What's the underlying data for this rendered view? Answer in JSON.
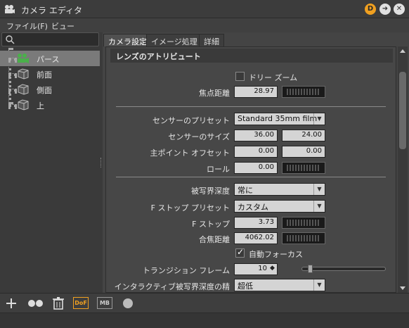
{
  "window": {
    "title": "カメラ エディタ",
    "buttons": {
      "d_label": "D",
      "go_label": "➜",
      "close_label": "✕"
    }
  },
  "menu": {
    "items": [
      "ファイル(F)",
      "ビュー"
    ]
  },
  "search": {
    "placeholder": ""
  },
  "tree": {
    "items": [
      {
        "label": "パース",
        "icon": "perspective-camera-icon",
        "selected": true
      },
      {
        "label": "前面",
        "icon": "ortho-camera-icon",
        "selected": false
      },
      {
        "label": "側面",
        "icon": "ortho-camera-icon",
        "selected": false
      },
      {
        "label": "上",
        "icon": "ortho-camera-icon",
        "selected": false
      }
    ]
  },
  "tabs": [
    {
      "label": "カメラ設定",
      "active": true
    },
    {
      "label": "イメージ処理",
      "active": false
    },
    {
      "label": "詳細",
      "active": false
    }
  ],
  "lens": {
    "header": "レンズのアトリビュート",
    "dolly_zoom_label": "ドリー ズーム",
    "dolly_zoom_checked": false,
    "focal_length_label": "焦点距離",
    "focal_length": "28.97",
    "sensor_preset_label": "センサーのプリセット",
    "sensor_preset": "Standard 35mm film",
    "sensor_size_label": "センサーのサイズ",
    "sensor_w": "36.00",
    "sensor_h": "24.00",
    "principal_offset_label": "主ポイント オフセット",
    "offset_x": "0.00",
    "offset_y": "0.00",
    "roll_label": "ロール",
    "roll": "0.00",
    "dof_label": "被写界深度",
    "dof": "常に",
    "fstop_preset_label": "F ストップ プリセット",
    "fstop_preset": "カスタム",
    "fstop_label": "F ストップ",
    "fstop": "3.73",
    "focus_distance_label": "合焦距離",
    "focus_distance": "4062.02",
    "autofocus_label": "自動フォーカス",
    "autofocus_checked": true,
    "transition_label": "トランジション フレーム",
    "transition": "10",
    "interactive_dof_label": "インタラクティブ被写界深度の精度",
    "interactive_dof": "超低"
  },
  "bottom": {
    "dof_badge": "DoF",
    "mb_badge": "MB"
  },
  "colors": {
    "accent": "#f0a020",
    "selected_row": "#7a7a7a",
    "panel": "#474747"
  }
}
